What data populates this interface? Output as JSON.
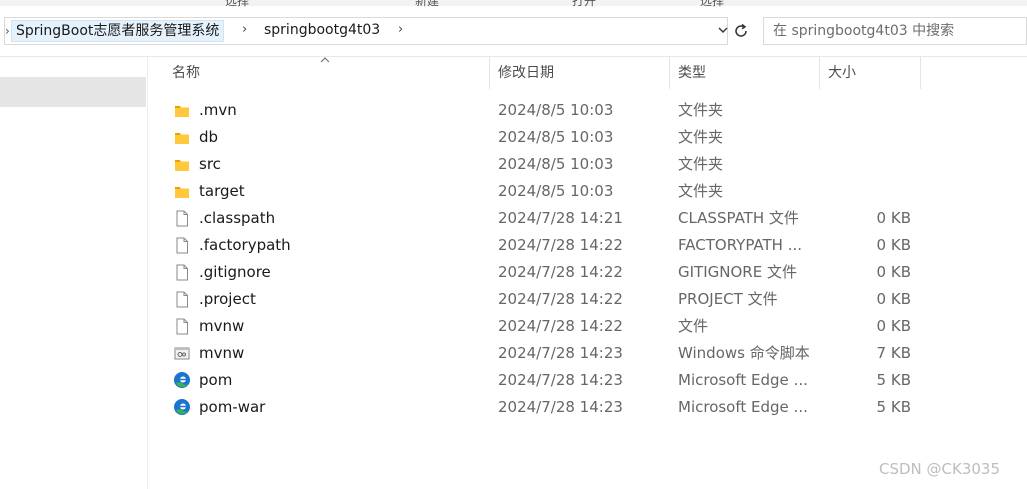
{
  "toolbar_cut": [
    "选择",
    "新建",
    "打开",
    "选择"
  ],
  "address": {
    "crumbs": [
      "SpringBoot志愿者服务管理系统",
      "springbootg4t03"
    ],
    "search_placeholder": "在 springbootg4t03 中搜索"
  },
  "columns": {
    "name": "名称",
    "date": "修改日期",
    "type": "类型",
    "size": "大小"
  },
  "files": [
    {
      "icon": "folder-icon",
      "name": ".mvn",
      "date": "2024/8/5 10:03",
      "type": "文件夹",
      "size": ""
    },
    {
      "icon": "folder-icon",
      "name": "db",
      "date": "2024/8/5 10:03",
      "type": "文件夹",
      "size": ""
    },
    {
      "icon": "folder-icon",
      "name": "src",
      "date": "2024/8/5 10:03",
      "type": "文件夹",
      "size": ""
    },
    {
      "icon": "folder-icon",
      "name": "target",
      "date": "2024/8/5 10:03",
      "type": "文件夹",
      "size": ""
    },
    {
      "icon": "file-icon",
      "name": ".classpath",
      "date": "2024/7/28 14:21",
      "type": "CLASSPATH 文件",
      "size": "0 KB"
    },
    {
      "icon": "file-icon",
      "name": ".factorypath",
      "date": "2024/7/28 14:22",
      "type": "FACTORYPATH ...",
      "size": "0 KB"
    },
    {
      "icon": "file-icon",
      "name": ".gitignore",
      "date": "2024/7/28 14:22",
      "type": "GITIGNORE 文件",
      "size": "0 KB"
    },
    {
      "icon": "file-icon",
      "name": ".project",
      "date": "2024/7/28 14:22",
      "type": "PROJECT 文件",
      "size": "0 KB"
    },
    {
      "icon": "file-icon",
      "name": "mvnw",
      "date": "2024/7/28 14:22",
      "type": "文件",
      "size": "0 KB"
    },
    {
      "icon": "script-icon",
      "name": "mvnw",
      "date": "2024/7/28 14:23",
      "type": "Windows 命令脚本",
      "size": "7 KB"
    },
    {
      "icon": "edge-icon",
      "name": "pom",
      "date": "2024/7/28 14:23",
      "type": "Microsoft Edge ...",
      "size": "5 KB"
    },
    {
      "icon": "edge-icon",
      "name": "pom-war",
      "date": "2024/7/28 14:23",
      "type": "Microsoft Edge ...",
      "size": "5 KB"
    }
  ],
  "colors": {
    "folder": "#ffc83d",
    "folder_dark": "#e8a202",
    "edge_blue": "#1b75d0",
    "edge_green": "#39b54a",
    "crumb_highlight": "#e5f1fb"
  },
  "watermark": "CSDN @CK3035"
}
